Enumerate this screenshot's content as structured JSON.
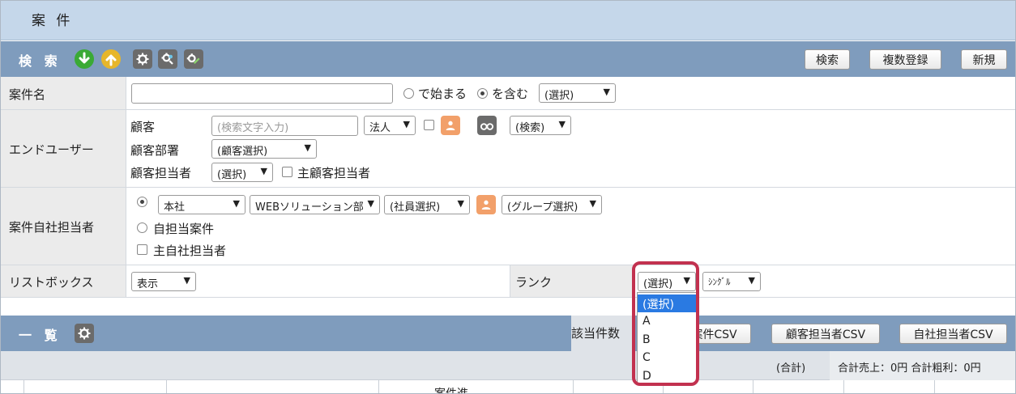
{
  "page": {
    "title": "案 件"
  },
  "search": {
    "label": "検 索",
    "buttons": {
      "search": "検索",
      "bulk_register": "複数登録",
      "new": "新規"
    }
  },
  "rows": {
    "case_name": {
      "label": "案件名",
      "starts_with": "で始まる",
      "contains": "を含む",
      "select": "(選択)"
    },
    "end_user": {
      "label": "エンドユーザー",
      "customer_label": "顧客",
      "customer_placeholder": "(検索文字入力)",
      "corp_select": "法人",
      "search_select": "(検索)",
      "dept_label": "顧客部署",
      "dept_select": "(顧客選択)",
      "rep_label": "顧客担当者",
      "rep_select": "(選択)",
      "main_rep": "主顧客担当者"
    },
    "own_rep": {
      "label": "案件自社担当者",
      "office_select": "本社",
      "dept_select": "WEBソリューション部",
      "staff_select": "(社員選択)",
      "group_select": "(グループ選択)",
      "own_case": "自担当案件",
      "main_own_rep": "主自社担当者"
    },
    "listbox": {
      "label": "リストボックス",
      "display_select": "表示",
      "rank_label": "ランク",
      "rank_select": "(選択)",
      "single_select": "ｼﾝｸﾞﾙ"
    }
  },
  "rank_dropdown": {
    "options": [
      "(選択)",
      "A",
      "B",
      "C",
      "D"
    ],
    "selected_index": 0
  },
  "list": {
    "label": "一 覧",
    "hits_label": "該当件数",
    "buttons": {
      "case_csv": "案件CSV",
      "customer_rep_csv": "顧客担当者CSV",
      "own_rep_csv": "自社担当者CSV"
    },
    "totals_label": "(合計)",
    "totals_sum": "合計売上：0円 合計粗利：0円",
    "table_caption": "案件進"
  },
  "colors": {
    "bar": "#7f9cbd",
    "title_bar": "#c5d7ea",
    "highlight": "#c2314f",
    "selected_option": "#2a7ae2"
  }
}
